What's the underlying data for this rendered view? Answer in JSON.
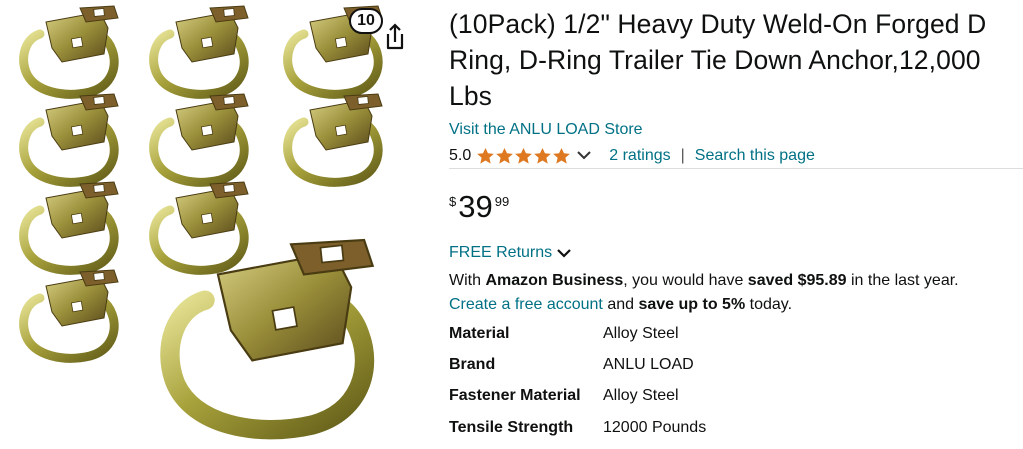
{
  "gallery": {
    "pack_badge": "10",
    "share_icon": "share-icon",
    "image_alt": "D-ring tie down anchors"
  },
  "product": {
    "title": "(10Pack) 1/2\" Heavy Duty Weld-On Forged D Ring, D-Ring Trailer Tie Down Anchor,12,000 Lbs",
    "store_link": "Visit the ANLU LOAD Store",
    "rating_value": "5.0",
    "rating_stars": 5,
    "ratings_count": "2 ratings",
    "separator": "|",
    "search_link": "Search this page",
    "price_symbol": "$",
    "price_whole": "39",
    "price_fraction": "99",
    "returns_link": "FREE Returns",
    "star_color": "#de7921",
    "link_color": "#007185"
  },
  "business": {
    "line1_prefix": "With ",
    "line1_bold": "Amazon Business",
    "line1_mid": ", you would have ",
    "line1_saved": "saved $95.89",
    "line1_suffix": " in the last year.",
    "create_link": "Create a free account",
    "line2_mid": " and ",
    "line2_bold": "save up to 5%",
    "line2_suffix": " today."
  },
  "specs": [
    {
      "key": "Material",
      "value": "Alloy Steel"
    },
    {
      "key": "Brand",
      "value": "ANLU LOAD"
    },
    {
      "key": "Fastener Material",
      "value": "Alloy Steel"
    },
    {
      "key": "Tensile Strength",
      "value": "12000 Pounds"
    }
  ]
}
